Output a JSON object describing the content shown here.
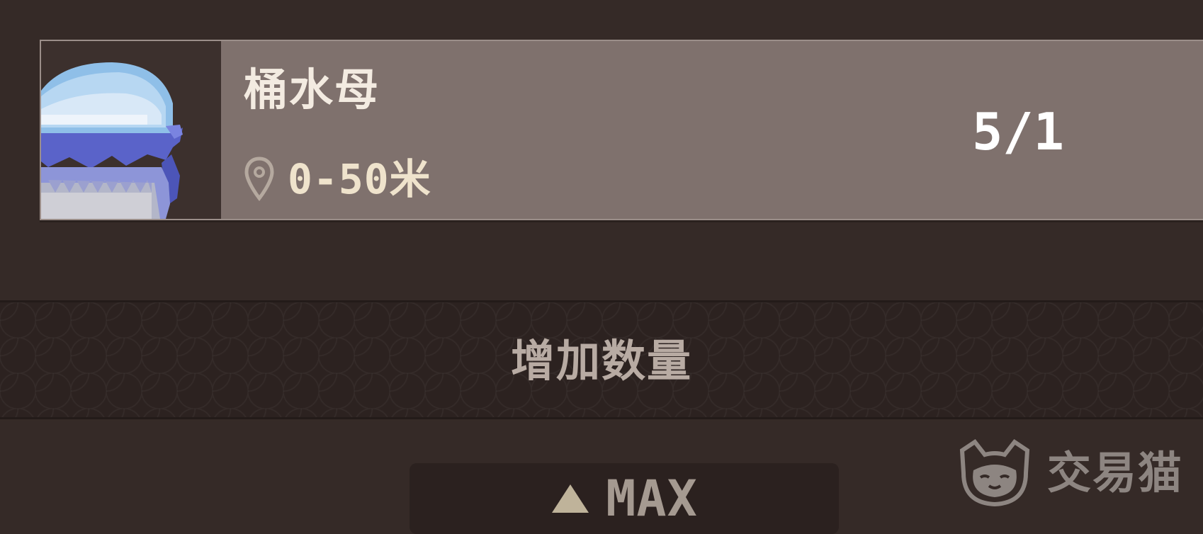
{
  "item": {
    "name": "桶水母",
    "depth": "0-50米",
    "count": "5/1",
    "icon": "jellyfish-icon"
  },
  "increase": {
    "label": "增加数量"
  },
  "max_button": {
    "label": "MAX",
    "icon": "triangle-up-icon"
  },
  "watermark": {
    "text": "交易猫",
    "icon": "cat-icon"
  },
  "colors": {
    "background": "#352a27",
    "card": "#7f716d",
    "band": "#2c2220"
  }
}
